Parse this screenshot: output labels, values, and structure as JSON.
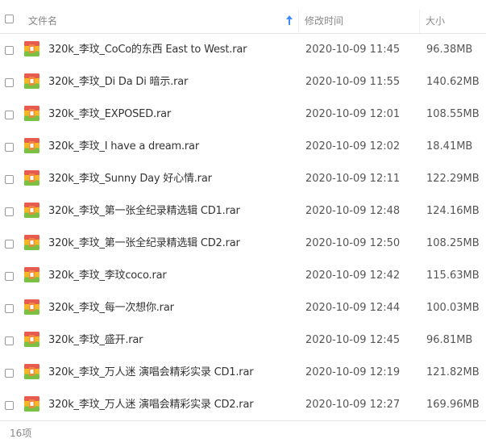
{
  "header": {
    "col_name": "文件名",
    "col_time": "修改时间",
    "col_size": "大小"
  },
  "files": [
    {
      "name": "320k_李玟_CoCo的东西 East to West.rar",
      "time": "2020-10-09 11:45",
      "size": "96.38MB"
    },
    {
      "name": "320k_李玟_Di Da Di 暗示.rar",
      "time": "2020-10-09 11:55",
      "size": "140.62MB"
    },
    {
      "name": "320k_李玟_EXPOSED.rar",
      "time": "2020-10-09 12:01",
      "size": "108.55MB"
    },
    {
      "name": "320k_李玟_I have a dream.rar",
      "time": "2020-10-09 12:02",
      "size": "18.41MB"
    },
    {
      "name": "320k_李玟_Sunny Day 好心情.rar",
      "time": "2020-10-09 12:11",
      "size": "122.29MB"
    },
    {
      "name": "320k_李玟_第一张全纪录精选辑 CD1.rar",
      "time": "2020-10-09 12:48",
      "size": "124.16MB"
    },
    {
      "name": "320k_李玟_第一张全纪录精选辑 CD2.rar",
      "time": "2020-10-09 12:50",
      "size": "108.25MB"
    },
    {
      "name": "320k_李玟_李玟coco.rar",
      "time": "2020-10-09 12:42",
      "size": "115.63MB"
    },
    {
      "name": "320k_李玟_每一次想你.rar",
      "time": "2020-10-09 12:44",
      "size": "100.03MB"
    },
    {
      "name": "320k_李玟_盛开.rar",
      "time": "2020-10-09 12:45",
      "size": "96.81MB"
    },
    {
      "name": "320k_李玟_万人迷 演唱会精彩实录 CD1.rar",
      "time": "2020-10-09 12:19",
      "size": "121.82MB"
    },
    {
      "name": "320k_李玟_万人迷 演唱会精彩实录 CD2.rar",
      "time": "2020-10-09 12:27",
      "size": "169.96MB"
    }
  ],
  "footer": {
    "count": "16项"
  },
  "icons": {
    "sort": "sort-ascending-arrow-icon",
    "file": "rar-archive-icon"
  },
  "colors": {
    "sort_arrow": "#3b8cff",
    "icon_top": "#e95b4f",
    "icon_mid": "#f5b728",
    "icon_bottom": "#7ac142",
    "icon_band": "#f08a3c"
  }
}
